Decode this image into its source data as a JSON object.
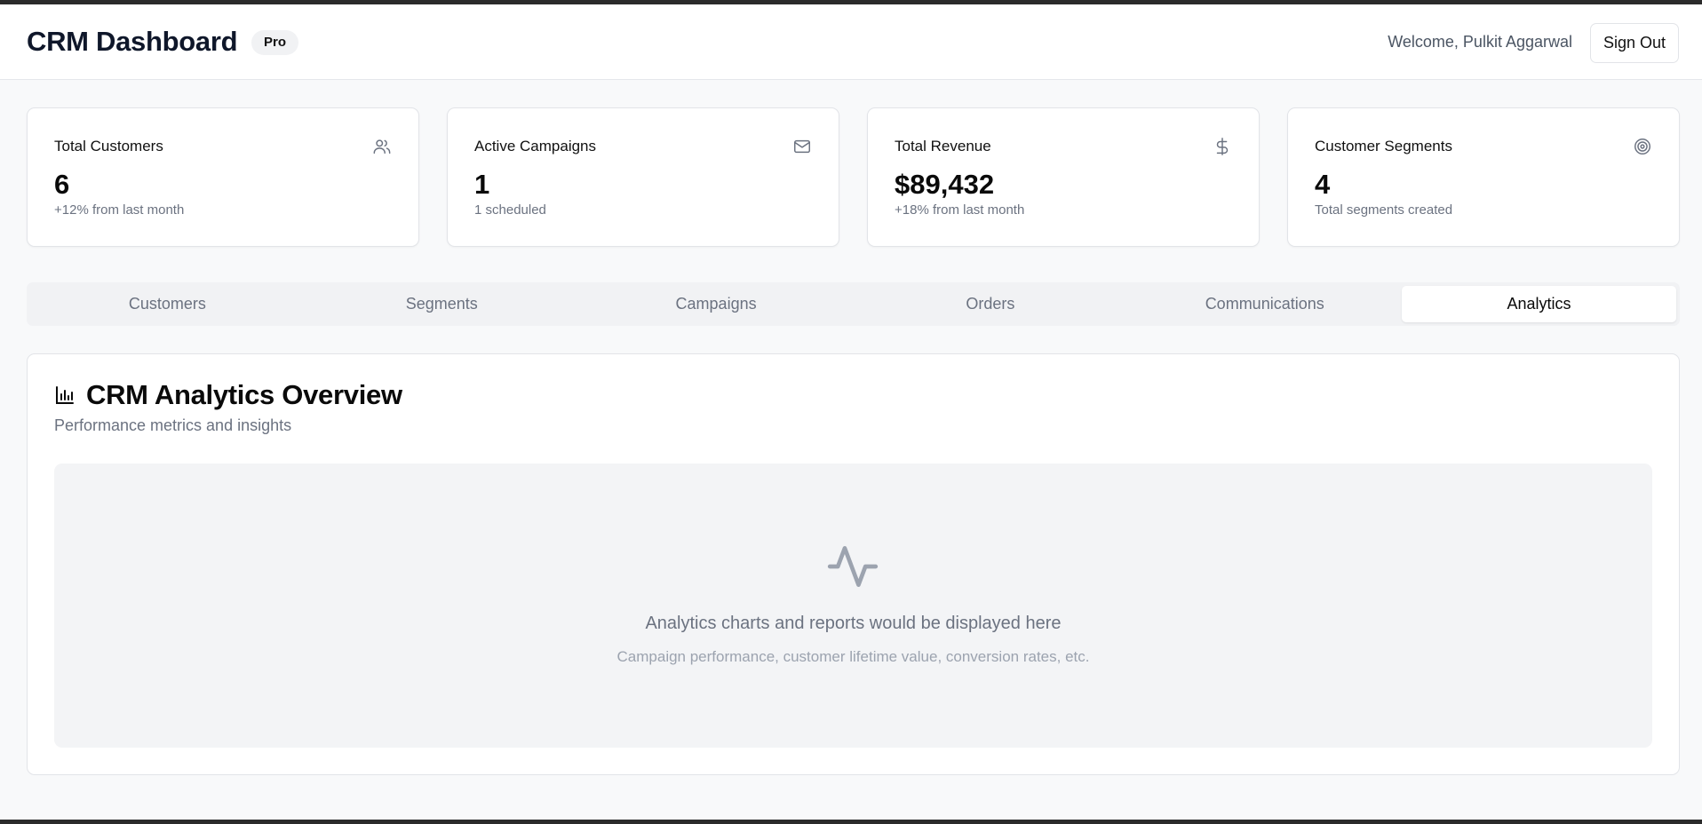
{
  "header": {
    "title": "CRM Dashboard",
    "badge": "Pro",
    "welcome": "Welcome, Pulkit Aggarwal",
    "sign_out_label": "Sign Out"
  },
  "stats": [
    {
      "label": "Total Customers",
      "value": "6",
      "sub": "+12% from last month",
      "icon": "users-icon"
    },
    {
      "label": "Active Campaigns",
      "value": "1",
      "sub": "1 scheduled",
      "icon": "mail-icon"
    },
    {
      "label": "Total Revenue",
      "value": "$89,432",
      "sub": "+18% from last month",
      "icon": "dollar-icon"
    },
    {
      "label": "Customer Segments",
      "value": "4",
      "sub": "Total segments created",
      "icon": "target-icon"
    }
  ],
  "tabs": [
    {
      "label": "Customers",
      "active": false
    },
    {
      "label": "Segments",
      "active": false
    },
    {
      "label": "Campaigns",
      "active": false
    },
    {
      "label": "Orders",
      "active": false
    },
    {
      "label": "Communications",
      "active": false
    },
    {
      "label": "Analytics",
      "active": true
    }
  ],
  "panel": {
    "icon": "bar-chart-icon",
    "title": "CRM Analytics Overview",
    "subtitle": "Performance metrics and insights",
    "placeholder_icon": "activity-icon",
    "placeholder_title": "Analytics charts and reports would be displayed here",
    "placeholder_subtitle": "Campaign performance, customer lifetime value, conversion rates, etc."
  },
  "colors": {
    "background": "#f8f9fa",
    "card": "#ffffff",
    "border": "#e2e4e8",
    "muted_text": "#6b7280",
    "tab_track": "#f1f2f4",
    "placeholder_bg": "#f3f4f6"
  }
}
